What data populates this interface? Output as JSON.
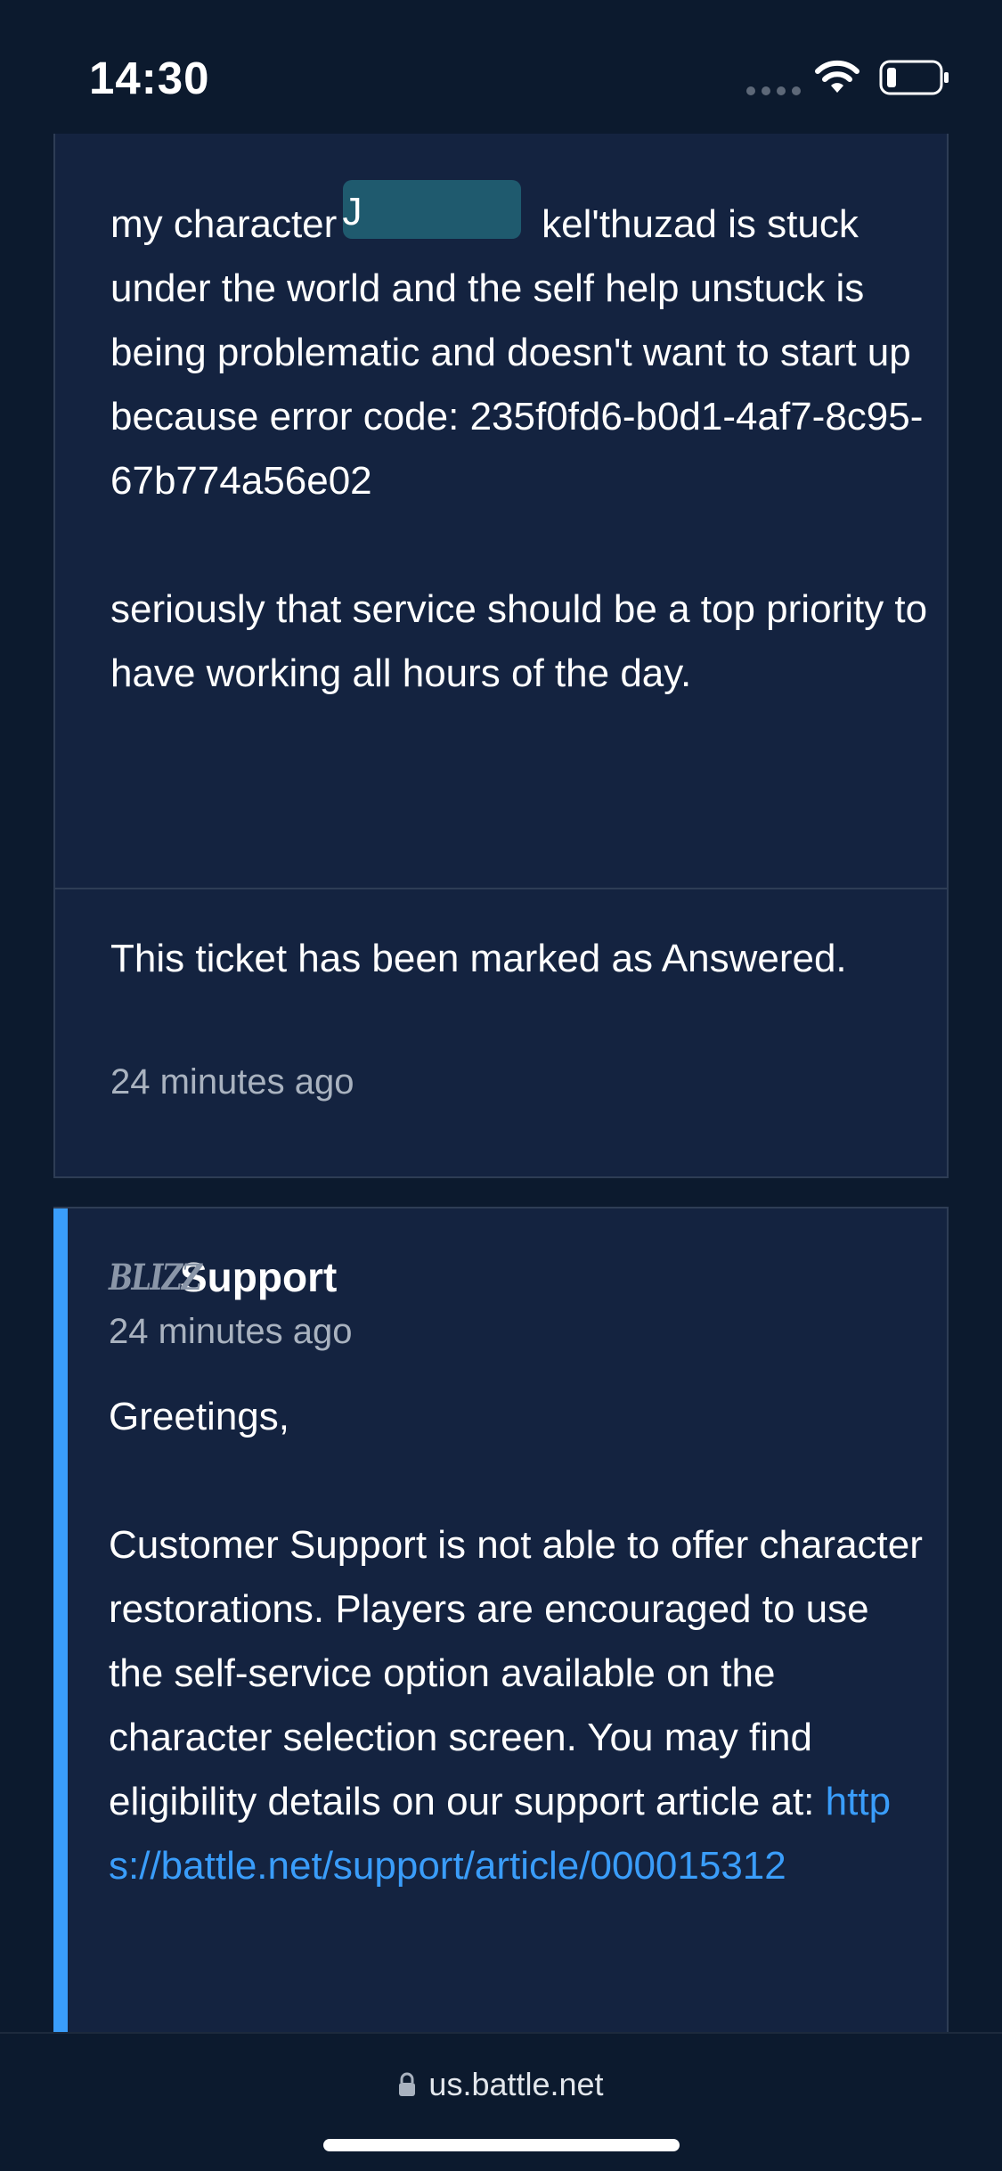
{
  "status_bar": {
    "time": "14:30"
  },
  "ticket": {
    "description": {
      "text_before_redaction": "my character ",
      "redacted_fragment": "J",
      "text_after_redaction": " kel'thuzad is stuck under the world and the self help unstuck is being problematic and doesn't want to start up because error code: 235f0fd6-b0d1-4af7-8c95-67b774a56e02",
      "paragraph_2": "seriously that service should be a top priority to have working all hours of the day."
    },
    "status_update": {
      "message": "This ticket has been marked as Answered.",
      "timestamp": "24 minutes ago"
    },
    "reply": {
      "logo_text": "BLIZZ",
      "author": "Support",
      "timestamp": "24 minutes ago",
      "greeting": "Greetings,",
      "body": "Customer Support is not able to offer character restorations. Players are encouraged to use the self-service option available on the character selection screen. You may find eligibility details on our support article at:",
      "link_text": "https://battle.net/support/article/000015312"
    }
  },
  "browser": {
    "url": "us.battle.net"
  },
  "colors": {
    "background": "#0c1a2e",
    "card": "#142340",
    "accent": "#3a9dfa",
    "muted_text": "#a9b2bf",
    "redaction": "#1f5a6e"
  },
  "icons": [
    "wifi-icon",
    "battery-icon",
    "lock-icon",
    "blizzard-logo"
  ]
}
